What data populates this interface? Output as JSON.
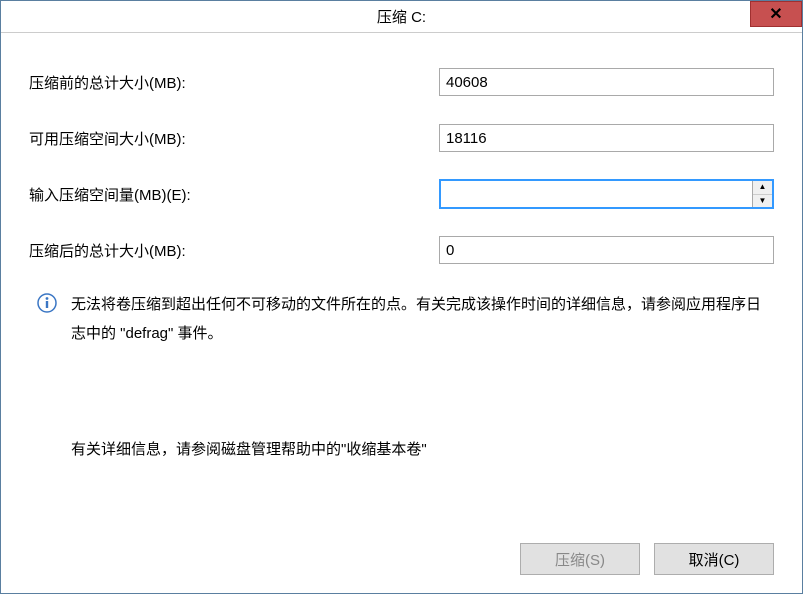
{
  "window": {
    "title": "压缩 C:"
  },
  "form": {
    "total_before_label": "压缩前的总计大小(MB):",
    "total_before_value": "40608",
    "available_label": "可用压缩空间大小(MB):",
    "available_value": "18116",
    "input_amount_label": "输入压缩空间量(MB)(E):",
    "input_amount_value": "",
    "total_after_label": "压缩后的总计大小(MB):",
    "total_after_value": "0"
  },
  "info": {
    "text": "无法将卷压缩到超出任何不可移动的文件所在的点。有关完成该操作时间的详细信息，请参阅应用程序日志中的 \"defrag\" 事件。"
  },
  "help": {
    "text": "有关详细信息，请参阅磁盘管理帮助中的\"收缩基本卷\""
  },
  "buttons": {
    "shrink": "压缩(S)",
    "cancel": "取消(C)"
  }
}
